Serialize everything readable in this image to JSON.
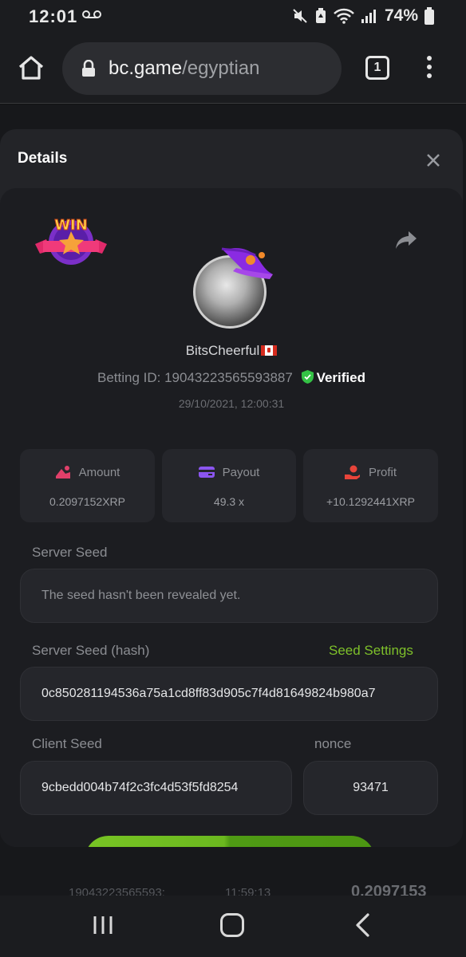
{
  "status_bar": {
    "time": "12:01",
    "battery": "74%"
  },
  "browser": {
    "url_host": "bc.game",
    "url_path": "/egyptian",
    "tab_count": "1"
  },
  "background": {
    "row_id": "19043223565593:",
    "row_time": "11:59:13",
    "row_amount": "0.2097153"
  },
  "modal": {
    "title": "Details",
    "username": "BitsCheerful",
    "betting_id": "Betting ID: 19043223565593887",
    "verified_label": "Verified",
    "datetime": "29/10/2021, 12:00:31",
    "stats": [
      {
        "label": "Amount",
        "value": "0.2097152XRP",
        "icon": "coins-icon",
        "color": "#e0406a"
      },
      {
        "label": "Payout",
        "value": "49.3 x",
        "icon": "card-icon",
        "color": "#8b55ef"
      },
      {
        "label": "Profit",
        "value": "+10.1292441XRP",
        "icon": "hand-coin-icon",
        "color": "#e8443a"
      }
    ],
    "server_seed_label": "Server Seed",
    "server_seed_value": "The seed hasn't been revealed yet.",
    "server_seed_hash_label": "Server Seed (hash)",
    "seed_settings_link": "Seed Settings",
    "server_seed_hash_value": "0c850281194536a75a1cd8ff83d905c7f4d81649824b980a7",
    "client_seed_label": "Client Seed",
    "client_seed_value": "9cbedd004b74f2c3fc4d53f5fd8254",
    "nonce_label": "nonce",
    "nonce_value": "93471"
  },
  "colors": {
    "accent_green": "#7ec02a",
    "verified_green": "#34c245",
    "modal_bg": "#232428"
  }
}
